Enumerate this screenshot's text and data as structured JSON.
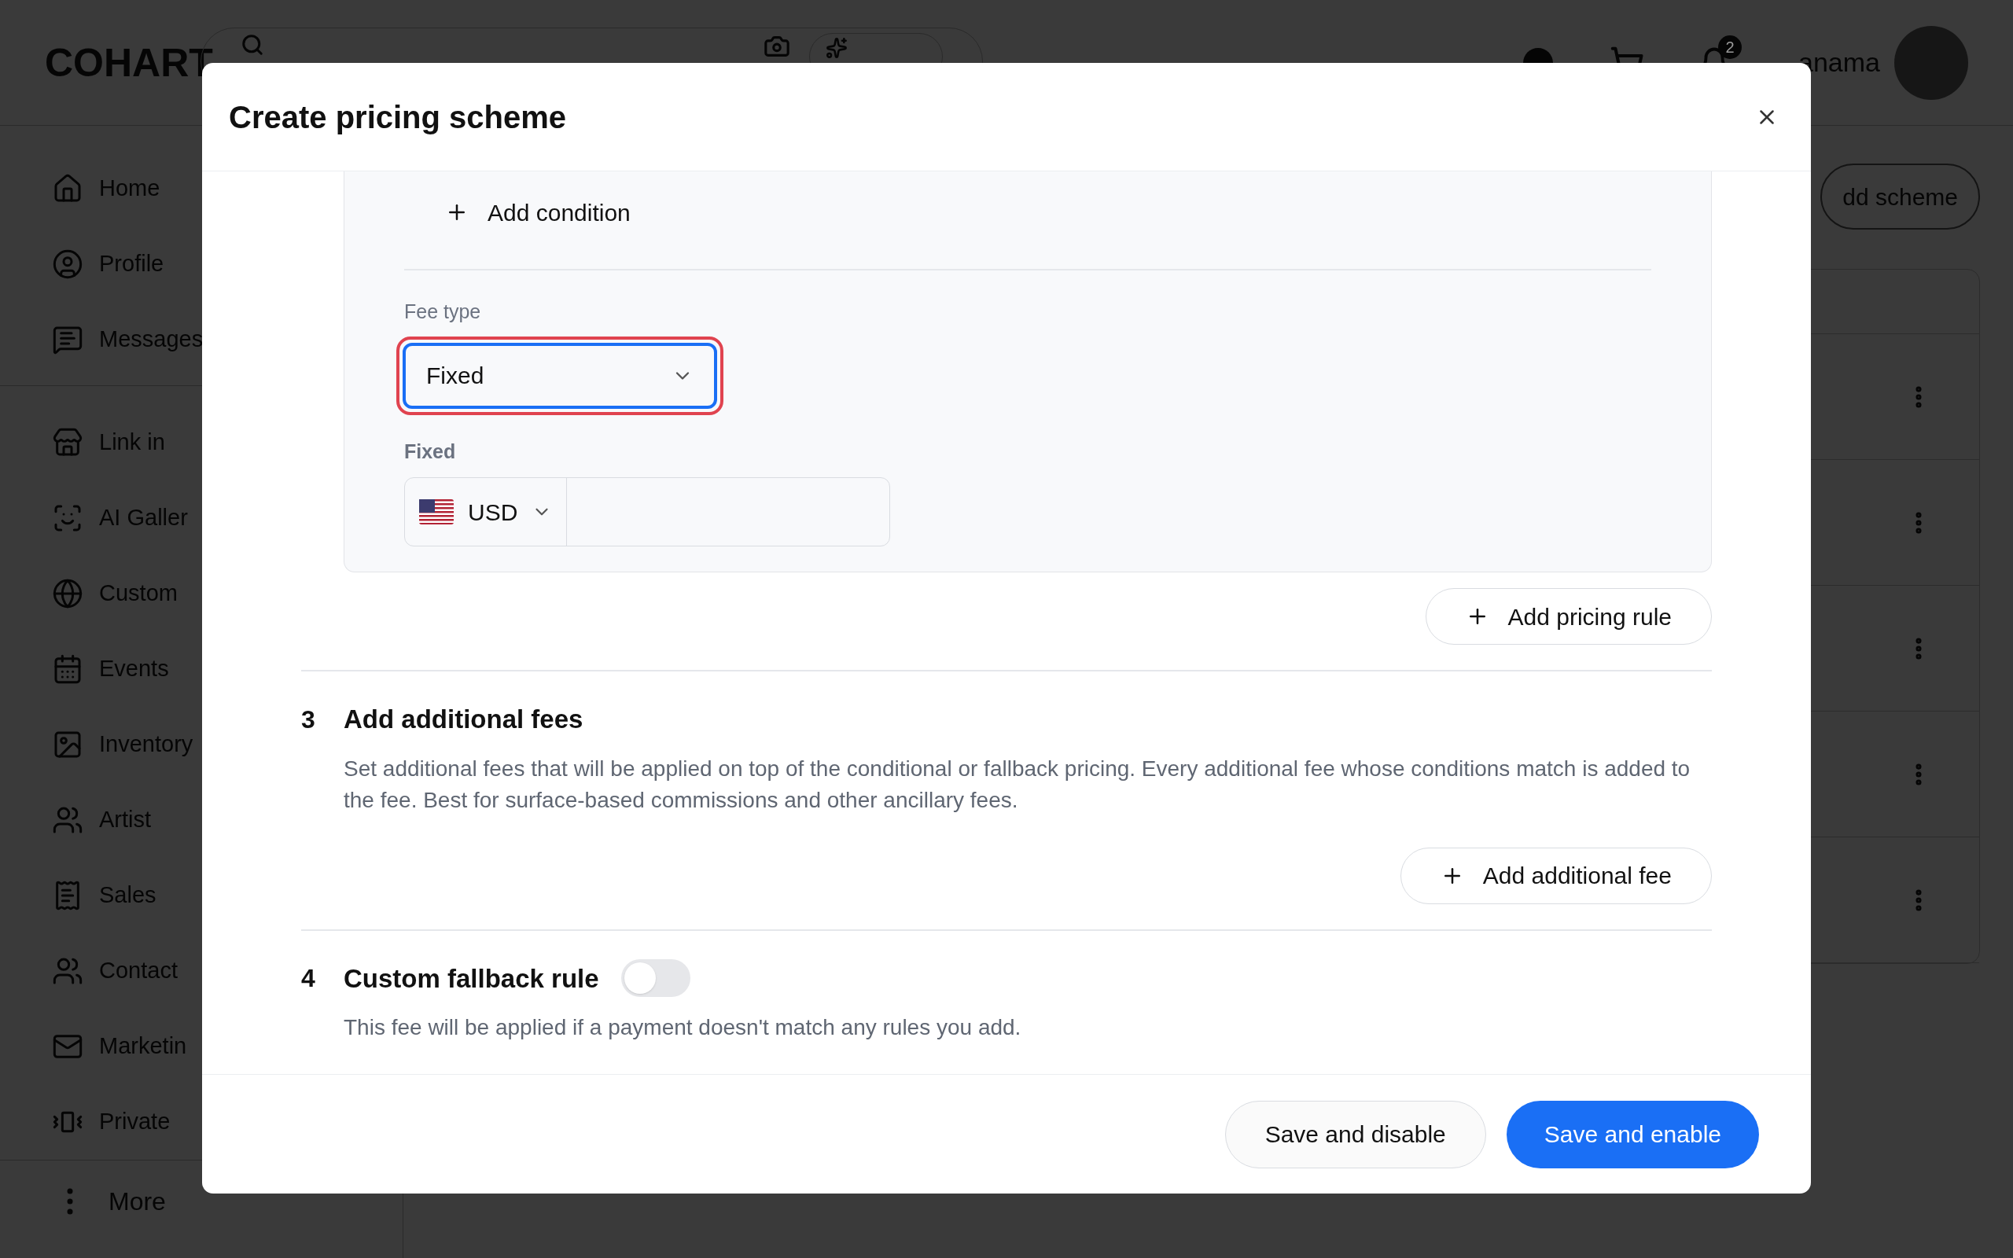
{
  "topbar": {
    "logo": "COHART",
    "notification_count": "2",
    "username": "anama"
  },
  "sidebar": {
    "groups": [
      [
        {
          "label": "Home"
        },
        {
          "label": "Profile"
        },
        {
          "label": "Messages"
        }
      ],
      [
        {
          "label": "Link in"
        },
        {
          "label": "AI Galler"
        },
        {
          "label": "Custom"
        },
        {
          "label": "Events"
        },
        {
          "label": "Inventory"
        },
        {
          "label": "Artist"
        },
        {
          "label": "Sales"
        },
        {
          "label": "Contact"
        },
        {
          "label": "Marketin"
        },
        {
          "label": "Private"
        }
      ]
    ],
    "more": "More"
  },
  "background": {
    "add_scheme": "dd scheme"
  },
  "modal": {
    "title": "Create pricing scheme",
    "add_condition": "Add condition",
    "fee_type": {
      "label": "Fee type",
      "value": "Fixed",
      "highlighted": true
    },
    "fixed": {
      "label": "Fixed",
      "currency": "USD"
    },
    "add_pricing_rule": "Add pricing rule",
    "sections": [
      {
        "number": "3",
        "title": "Add additional fees",
        "description": "Set additional fees that will be applied on top of the conditional or fallback pricing. Every additional fee whose conditions match is added to the fee. Best for surface-based commissions and other ancillary fees.",
        "button": "Add additional fee"
      },
      {
        "number": "4",
        "title": "Custom fallback rule",
        "toggle": {
          "on": false
        },
        "description": "This fee will be applied if a payment doesn't match any rules you add."
      }
    ],
    "footer": {
      "secondary": "Save and disable",
      "primary": "Save and enable"
    }
  }
}
